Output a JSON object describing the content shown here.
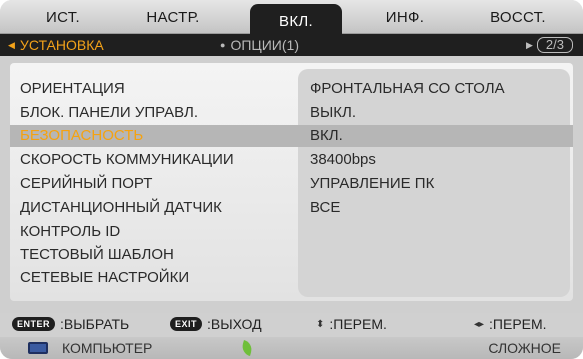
{
  "tabs": [
    "ИСТ.",
    "НАСТР.",
    "ВКЛ.",
    "ИНФ.",
    "ВОССТ."
  ],
  "subtabs": {
    "active": "УСТАНОВКА",
    "inactive": "ОПЦИИ(1)",
    "page": "2/3"
  },
  "rows": [
    {
      "label": "ОРИЕНТАЦИЯ",
      "value": "ФРОНТАЛЬНАЯ СО СТОЛА"
    },
    {
      "label": "БЛОК. ПАНЕЛИ УПРАВЛ.",
      "value": "ВЫКЛ."
    },
    {
      "label": "БЕЗОПАСНОСТЬ",
      "value": "ВКЛ."
    },
    {
      "label": "СКОРОСТЬ КОММУНИКАЦИИ",
      "value": "38400bps"
    },
    {
      "label": "СЕРИЙНЫЙ ПОРТ",
      "value": "УПРАВЛЕНИЕ ПК"
    },
    {
      "label": "ДИСТАНЦИОННЫЙ ДАТЧИК",
      "value": "ВСЕ"
    },
    {
      "label": "КОНТРОЛЬ ID",
      "value": ""
    },
    {
      "label": "ТЕСТОВЫЙ ШАБЛОН",
      "value": ""
    },
    {
      "label": "СЕТЕВЫЕ НАСТРОЙКИ",
      "value": ""
    }
  ],
  "help": {
    "enter_key": "ENTER",
    "enter_label": ":ВЫБРАТЬ",
    "exit_key": "EXIT",
    "exit_label": ":ВЫХОД",
    "updown_label": ":ПЕРЕМ.",
    "leftright_label": ":ПЕРЕМ."
  },
  "status": {
    "source": "КОМПЬЮТЕР",
    "mode": "СЛОЖНОЕ"
  },
  "colors": {
    "accent": "#f5a20f",
    "dark": "#1f1f1f"
  }
}
